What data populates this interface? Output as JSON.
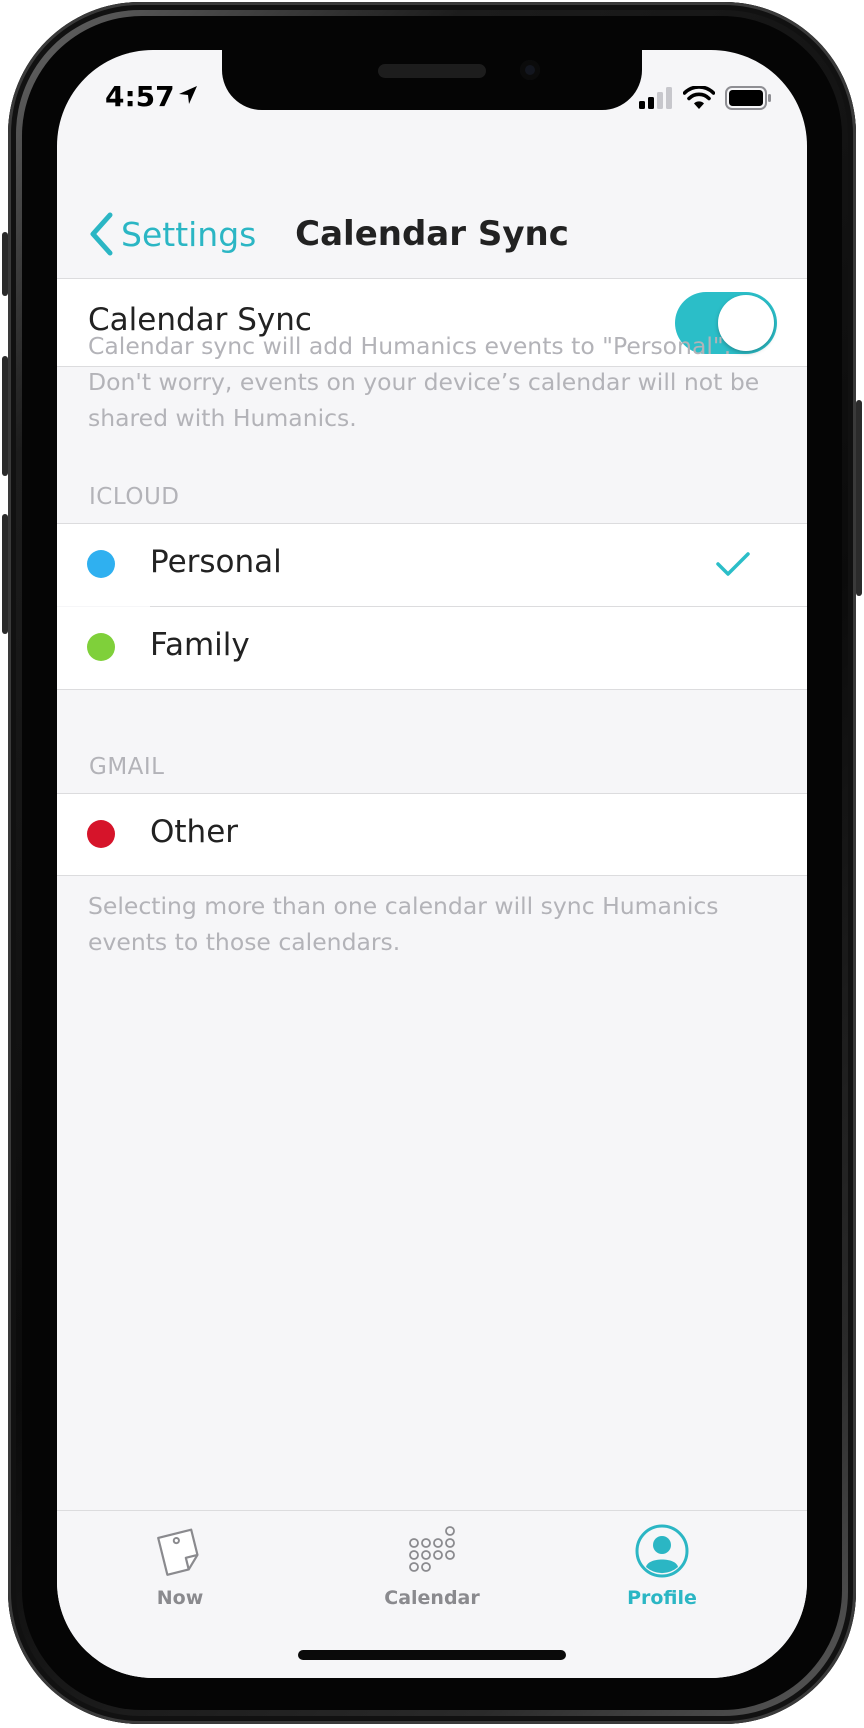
{
  "status_bar": {
    "time": "4:57"
  },
  "nav": {
    "back_label": "Settings",
    "title": "Calendar Sync"
  },
  "sync_toggle": {
    "label": "Calendar Sync",
    "enabled": true
  },
  "sync_note": "Calendar sync will add Humanics events to \"Personal\". Don't worry, events on your device’s calendar will not be shared with Humanics.",
  "sections": [
    {
      "header": "ICLOUD",
      "items": [
        {
          "label": "Personal",
          "color": "#2fb0f0",
          "selected": true
        },
        {
          "label": "Family",
          "color": "#7fd03a",
          "selected": false
        }
      ]
    },
    {
      "header": "GMAIL",
      "items": [
        {
          "label": "Other",
          "color": "#d6142a",
          "selected": false
        }
      ]
    }
  ],
  "bottom_note": "Selecting more than one calendar will sync Humanics events to those calendars.",
  "tabs": [
    {
      "label": "Now",
      "icon": "note-icon",
      "active": false
    },
    {
      "label": "Calendar",
      "icon": "dots-grid-icon",
      "active": false
    },
    {
      "label": "Profile",
      "icon": "profile-icon",
      "active": true
    }
  ],
  "colors": {
    "accent": "#2bb6c4",
    "inactive_tab": "#8a8a8e"
  }
}
